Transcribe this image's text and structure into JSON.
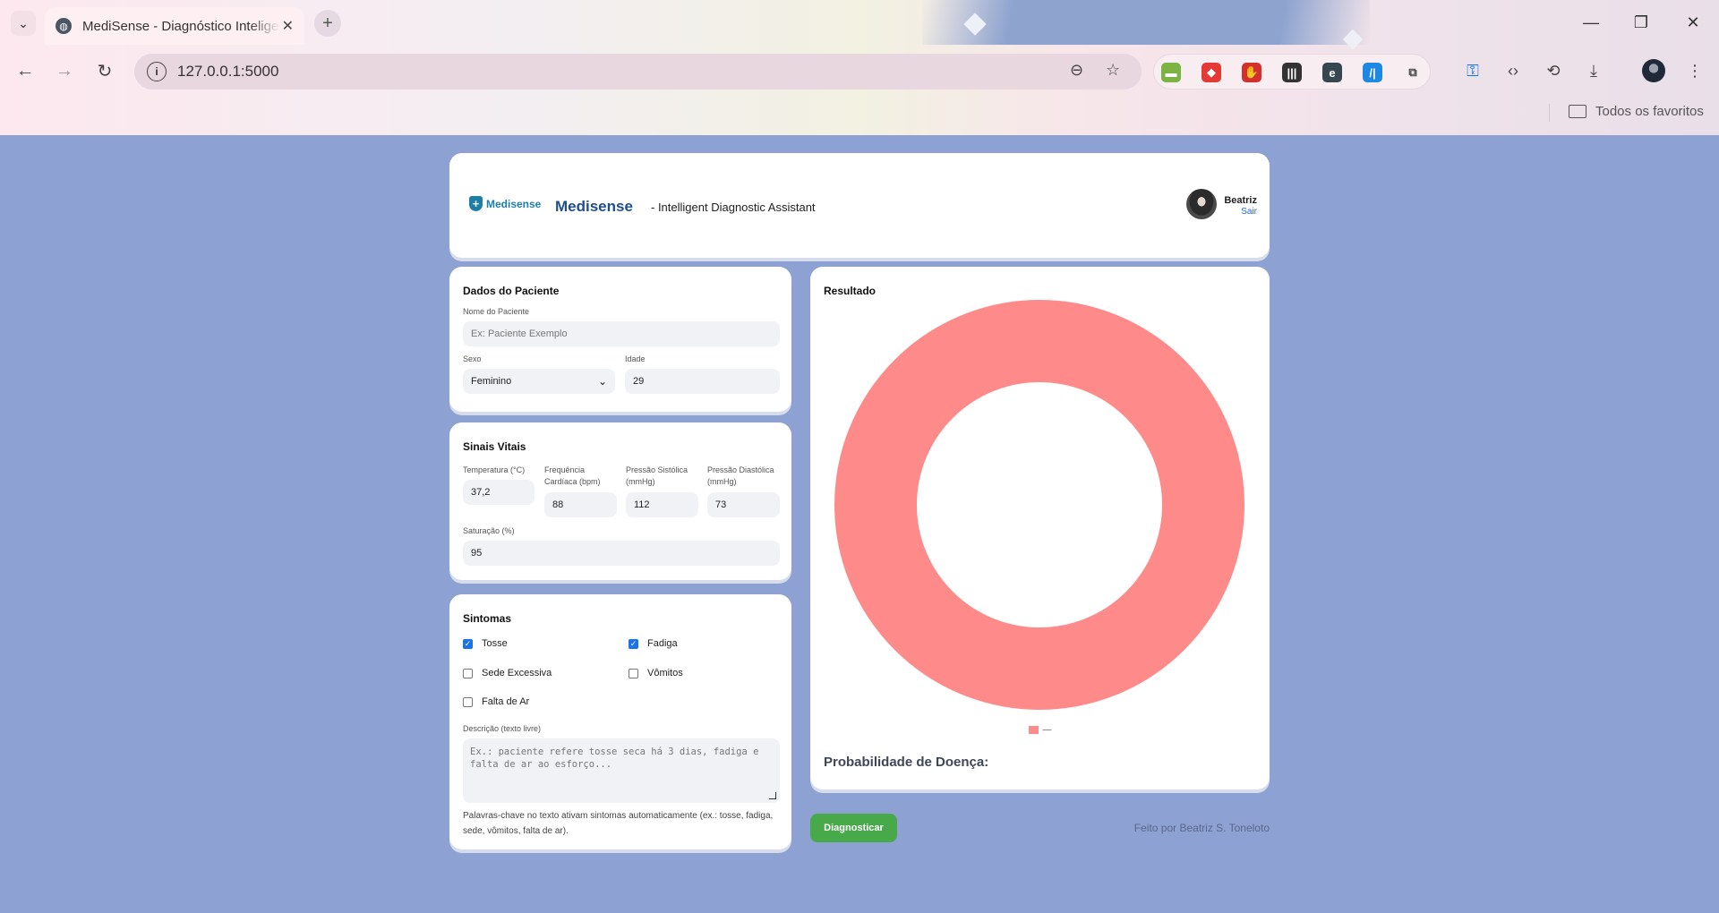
{
  "browser": {
    "tab_title": "MediSense - Diagnóstico Inteligente",
    "url": "127.0.0.1:5000",
    "bookmarks_label": "Todos os favoritos",
    "extensions": [
      {
        "name": "ext-green-icon",
        "color": "#7cb342"
      },
      {
        "name": "ext-red-arrow-icon",
        "color": "#e53935"
      },
      {
        "name": "ext-red-hand-icon",
        "color": "#d32f2f"
      },
      {
        "name": "ext-waveform-icon",
        "color": "#333333"
      },
      {
        "name": "ext-e-circle-icon",
        "color": "#37474f"
      },
      {
        "name": "ext-blue-bars-icon",
        "color": "#1e88e5"
      },
      {
        "name": "extensions-puzzle-icon",
        "color": "#444444"
      }
    ]
  },
  "header": {
    "logo_text": "Medisense",
    "title": "Medisense",
    "subtitle": "- Intelligent Diagnostic Assistant",
    "user_name": "Beatriz",
    "logout_label": "Sair"
  },
  "patient": {
    "section_title": "Dados do Paciente",
    "name_label": "Nome do Paciente",
    "name_placeholder": "Ex: Paciente Exemplo",
    "sex_label": "Sexo",
    "sex_value": "Feminino",
    "age_label": "Idade",
    "age_value": "29"
  },
  "vitals": {
    "section_title": "Sinais Vitais",
    "temp_label": "Temperatura (°C)",
    "temp_value": "37,2",
    "hr_label_1": "Frequência",
    "hr_label_2": "Cardíaca (bpm)",
    "hr_value": "88",
    "sys_label_1": "Pressão Sistólica",
    "sys_label_2": "(mmHg)",
    "sys_value": "112",
    "dia_label_1": "Pressão Diastólica",
    "dia_label_2": "(mmHg)",
    "dia_value": "73",
    "sat_label": "Saturação (%)",
    "sat_value": "95"
  },
  "symptoms": {
    "section_title": "Sintomas",
    "items": [
      {
        "label": "Tosse",
        "checked": true
      },
      {
        "label": "Fadiga",
        "checked": true
      },
      {
        "label": "Sede Excessiva",
        "checked": false
      },
      {
        "label": "Vômitos",
        "checked": false
      },
      {
        "label": "Falta de Ar",
        "checked": false
      }
    ],
    "desc_label": "Descrição (texto livre)",
    "desc_placeholder": "Ex.: paciente refere tosse seca há 3 dias, fadiga e falta de ar ao esforço...",
    "hint": "Palavras-chave no texto ativam sintomas automaticamente (ex.: tosse, fadiga, sede, vômitos, falta de ar)."
  },
  "result": {
    "section_title": "Resultado",
    "probability_label": "Probabilidade de Doença:",
    "legend_text": "—"
  },
  "chart_data": {
    "type": "pie",
    "donut": true,
    "categories": [
      "—"
    ],
    "values": [
      1
    ],
    "colors": [
      "#ff8a8a"
    ],
    "legend_position": "bottom"
  },
  "actions": {
    "diagnose_label": "Diagnosticar"
  },
  "footer": {
    "credit": "Feito por Beatriz S. Toneloto"
  }
}
